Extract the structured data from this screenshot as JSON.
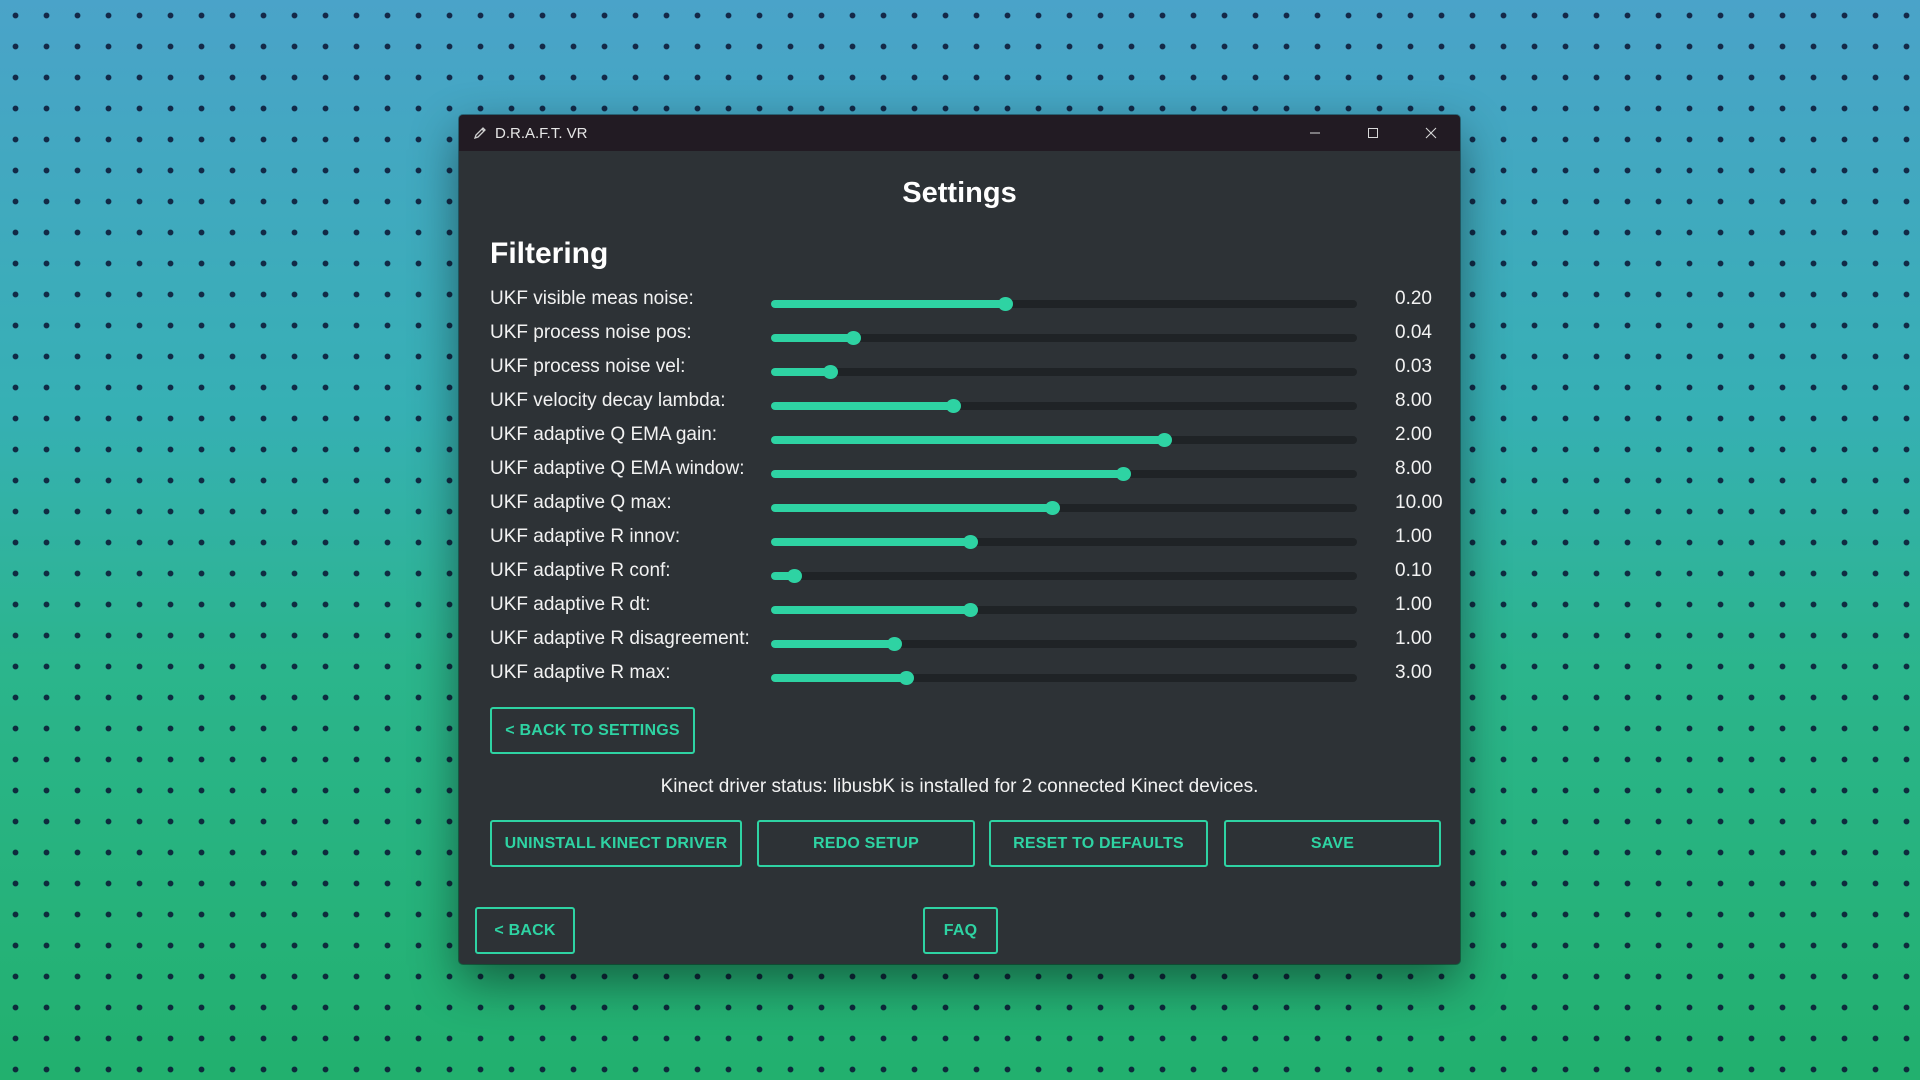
{
  "window": {
    "title": "D.R.A.F.T. VR"
  },
  "page_title": "Settings",
  "section_title": "Filtering",
  "colors": {
    "accent": "#2ed3a3",
    "window_bg": "#2d3236",
    "titlebar_bg": "#221b23"
  },
  "sliders": [
    {
      "label": "UKF visible meas noise:",
      "value": "0.20",
      "fill_fraction": 0.4
    },
    {
      "label": "UKF process noise pos:",
      "value": "0.04",
      "fill_fraction": 0.14
    },
    {
      "label": "UKF process noise vel:",
      "value": "0.03",
      "fill_fraction": 0.1
    },
    {
      "label": "UKF velocity decay lambda:",
      "value": "8.00",
      "fill_fraction": 0.31
    },
    {
      "label": "UKF adaptive Q EMA gain:",
      "value": "2.00",
      "fill_fraction": 0.67
    },
    {
      "label": "UKF adaptive Q EMA window:",
      "value": "8.00",
      "fill_fraction": 0.6
    },
    {
      "label": "UKF adaptive Q max:",
      "value": "10.00",
      "fill_fraction": 0.48
    },
    {
      "label": "UKF adaptive R innov:",
      "value": "1.00",
      "fill_fraction": 0.34
    },
    {
      "label": "UKF adaptive R conf:",
      "value": "0.10",
      "fill_fraction": 0.04
    },
    {
      "label": "UKF adaptive R dt:",
      "value": "1.00",
      "fill_fraction": 0.34
    },
    {
      "label": "UKF adaptive R disagreement:",
      "value": "1.00",
      "fill_fraction": 0.21
    },
    {
      "label": "UKF adaptive R max:",
      "value": "3.00",
      "fill_fraction": 0.23
    }
  ],
  "buttons": {
    "back_to_settings": "< BACK TO SETTINGS",
    "uninstall_driver": "UNINSTALL KINECT DRIVER",
    "redo_setup": "REDO SETUP",
    "reset_defaults": "RESET TO DEFAULTS",
    "save": "SAVE",
    "back": "< BACK",
    "faq": "FAQ"
  },
  "status_text": "Kinect driver status: libusbK is installed for 2 connected Kinect devices."
}
